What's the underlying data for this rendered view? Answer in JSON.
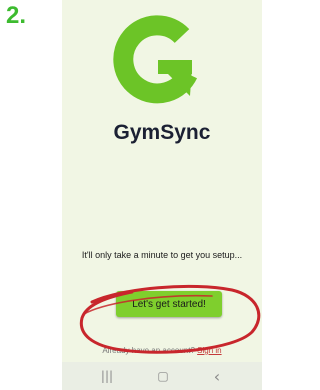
{
  "step": {
    "number": "2."
  },
  "app": {
    "name": "GymSync",
    "tagline": "It'll only take a minute to get you setup..."
  },
  "cta": {
    "label": "Let's get started!"
  },
  "signin": {
    "prompt": "Already have an account?",
    "link": "Sign in"
  },
  "nav": {
    "recents_icon": "recents-icon",
    "home_icon": "home-icon",
    "back_icon": "back-icon",
    "recents_glyph": "|||",
    "home_glyph": "▢",
    "back_glyph": "‹"
  },
  "colors": {
    "brand_green": "#7fcf2d",
    "logo_green": "#6cc427",
    "step_green": "#3dbb2f",
    "background": "#f1f6e4",
    "annotation_red": "#c8262c"
  }
}
